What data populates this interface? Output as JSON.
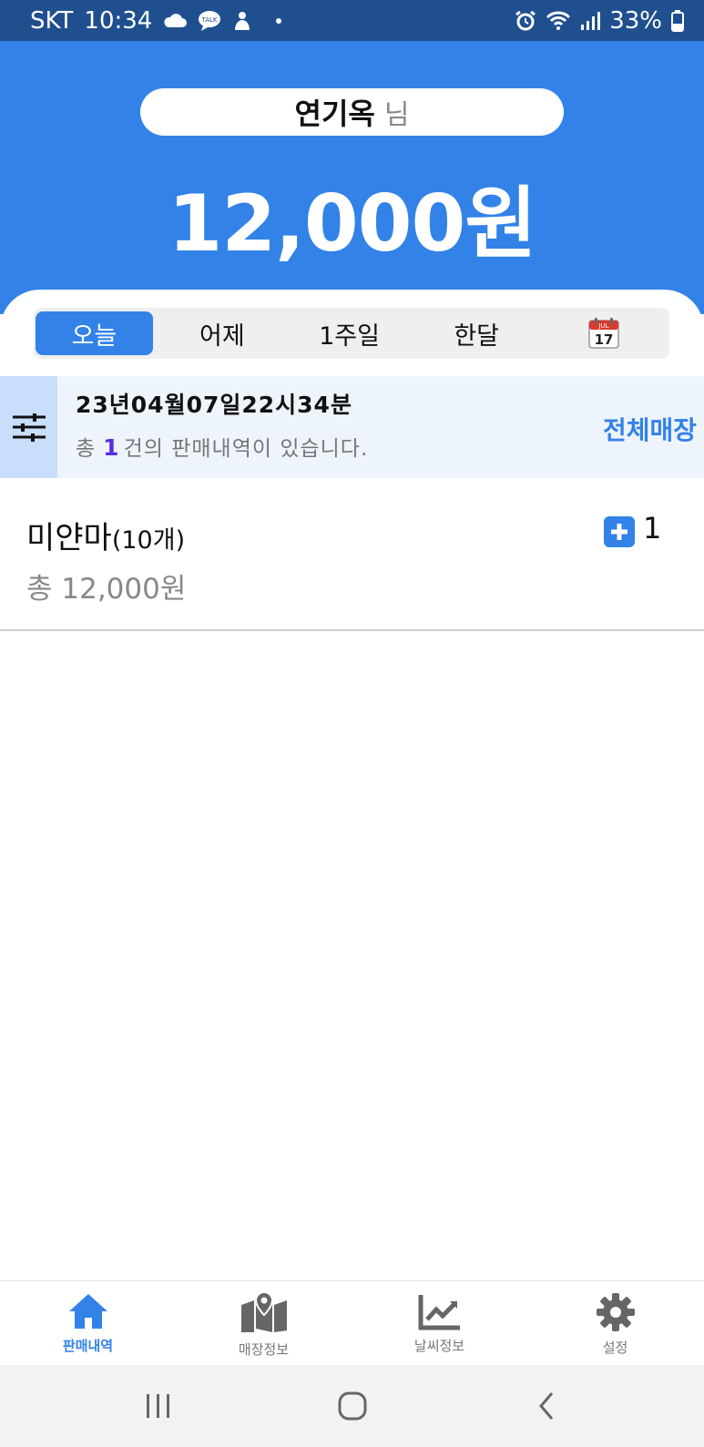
{
  "status_bar": {
    "carrier": "SKT",
    "time": "10:34",
    "battery": "33%",
    "icons": [
      "cloud-icon",
      "kakaotalk-icon",
      "notification-icon",
      "alarm-icon",
      "wifi-icon",
      "signal-icon",
      "battery-icon"
    ]
  },
  "header": {
    "user_name": "연기옥",
    "name_suffix": "님",
    "total_amount": "12,000원"
  },
  "tabs": [
    {
      "label": "오늘",
      "active": true
    },
    {
      "label": "어제",
      "active": false
    },
    {
      "label": "1주일",
      "active": false
    },
    {
      "label": "한달",
      "active": false
    }
  ],
  "calendar_icon": {
    "month": "JUL",
    "day": "17"
  },
  "summary": {
    "datetime": "23년04월07일22시34분",
    "count_prefix": "총",
    "count": "1",
    "count_suffix": "건의 판매내역이 있습니다.",
    "all_stores_label": "전체매장"
  },
  "items": [
    {
      "name": "미얀마",
      "qty": "(10개)",
      "total": "총 12,000원",
      "count": "1"
    }
  ],
  "bottom_nav": [
    {
      "label": "판매내역",
      "icon": "home-icon",
      "active": true
    },
    {
      "label": "매장정보",
      "icon": "map-pin-icon",
      "active": false
    },
    {
      "label": "날씨정보",
      "icon": "chart-line-icon",
      "active": false
    },
    {
      "label": "설정",
      "icon": "gear-icon",
      "active": false
    }
  ],
  "colors": {
    "primary": "#3282e8",
    "status_bar": "#1f4f8f",
    "summary_bg": "#eef4fc",
    "count_highlight": "#5a2de0"
  }
}
